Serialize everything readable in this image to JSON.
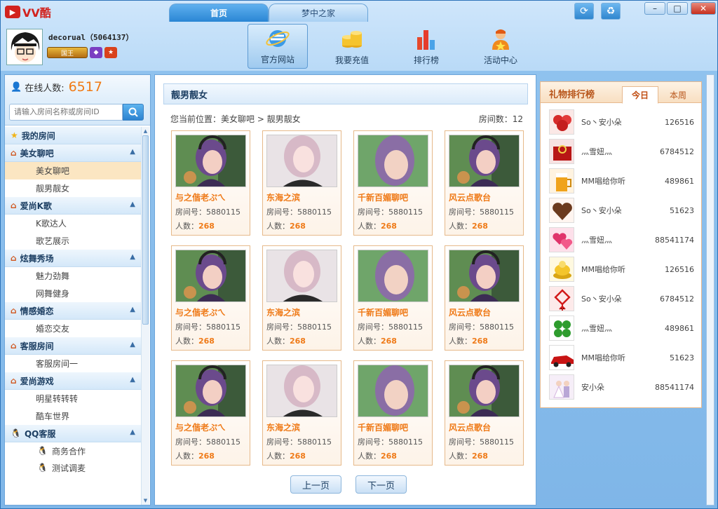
{
  "app": {
    "logo": "VV酷"
  },
  "tabs": [
    {
      "label": "首页",
      "active": true
    },
    {
      "label": "梦中之家",
      "active": false
    }
  ],
  "user": {
    "name": "decorual（5064137）",
    "badge_text": "国王"
  },
  "nav": [
    {
      "label": "官方网站",
      "icon": "ie-icon",
      "active": true
    },
    {
      "label": "我要充值",
      "icon": "coins-icon",
      "active": false
    },
    {
      "label": "排行榜",
      "icon": "bar-chart-icon",
      "active": false
    },
    {
      "label": "活动中心",
      "icon": "user-star-icon",
      "active": false
    }
  ],
  "sidebar": {
    "online_label": "在线人数:",
    "online_count": "6517",
    "search_placeholder": "请输入房间名称或房间ID",
    "my_room": "我的房间",
    "groups": [
      {
        "label": "美女聊吧",
        "items": [
          "美女聊吧",
          "靓男靓女"
        ]
      },
      {
        "label": "爱尚K歌",
        "items": [
          "K歌达人",
          "歌艺展示"
        ]
      },
      {
        "label": "炫舞秀场",
        "items": [
          "魅力劲舞",
          "网舞健身"
        ]
      },
      {
        "label": "情感婚恋",
        "items": [
          "婚恋交友"
        ]
      },
      {
        "label": "客服房间",
        "items": [
          "客服房间一"
        ]
      },
      {
        "label": "爱尚游戏",
        "items": [
          "明星转转转",
          "酷车世界"
        ]
      }
    ],
    "qq": {
      "label": "QQ客服",
      "items": [
        "商务合作",
        "测试调麦"
      ]
    }
  },
  "main": {
    "title": "靓男靓女",
    "breadcrumb": "您当前位置：美女聊吧 > 靓男靓女",
    "room_count": "房间数：12",
    "room_no_label": "房间号：",
    "people_label": "人数：",
    "rooms": [
      {
        "name": "与之偕老ぷㄟ",
        "id": "5880115",
        "count": "268"
      },
      {
        "name": "东海之滨",
        "id": "5880115",
        "count": "268"
      },
      {
        "name": "千新百媚聊吧",
        "id": "5880115",
        "count": "268"
      },
      {
        "name": "风云点歌台",
        "id": "5880115",
        "count": "268"
      },
      {
        "name": "与之偕老ぷㄟ",
        "id": "5880115",
        "count": "268"
      },
      {
        "name": "东海之滨",
        "id": "5880115",
        "count": "268"
      },
      {
        "name": "千新百媚聊吧",
        "id": "5880115",
        "count": "268"
      },
      {
        "name": "风云点歌台",
        "id": "5880115",
        "count": "268"
      },
      {
        "name": "与之偕老ぷㄟ",
        "id": "5880115",
        "count": "268"
      },
      {
        "name": "东海之滨",
        "id": "5880115",
        "count": "268"
      },
      {
        "name": "千新百媚聊吧",
        "id": "5880115",
        "count": "268"
      },
      {
        "name": "风云点歌台",
        "id": "5880115",
        "count": "268"
      }
    ],
    "prev": "上一页",
    "next": "下一页"
  },
  "ranking": {
    "title": "礼物排行榜",
    "tab_today": "今日",
    "tab_week": "本周",
    "items": [
      {
        "name": "So丶安小朵",
        "value": "126516",
        "icon": "roses-icon"
      },
      {
        "name": "灬雪妞灬",
        "value": "6784512",
        "icon": "ring-box-icon"
      },
      {
        "name": "MM唱给你听",
        "value": "489861",
        "icon": "beer-icon"
      },
      {
        "name": "So丶安小朵",
        "value": "51623",
        "icon": "chocolate-heart-icon"
      },
      {
        "name": "灬雪妞灬",
        "value": "88541174",
        "icon": "hearts-icon"
      },
      {
        "name": "MM唱给你听",
        "value": "126516",
        "icon": "gold-coins-icon"
      },
      {
        "name": "So丶安小朵",
        "value": "6784512",
        "icon": "chinese-knot-icon"
      },
      {
        "name": "灬雪妞灬",
        "value": "489861",
        "icon": "clover-icon"
      },
      {
        "name": "MM唱给你听",
        "value": "51623",
        "icon": "sports-car-icon"
      },
      {
        "name": "安小朵",
        "value": "88541174",
        "icon": "wedding-icon"
      }
    ]
  },
  "colors": {
    "accent": "#ef7a18",
    "brand": "#d2231e",
    "panel_border": "#6ea6da"
  }
}
